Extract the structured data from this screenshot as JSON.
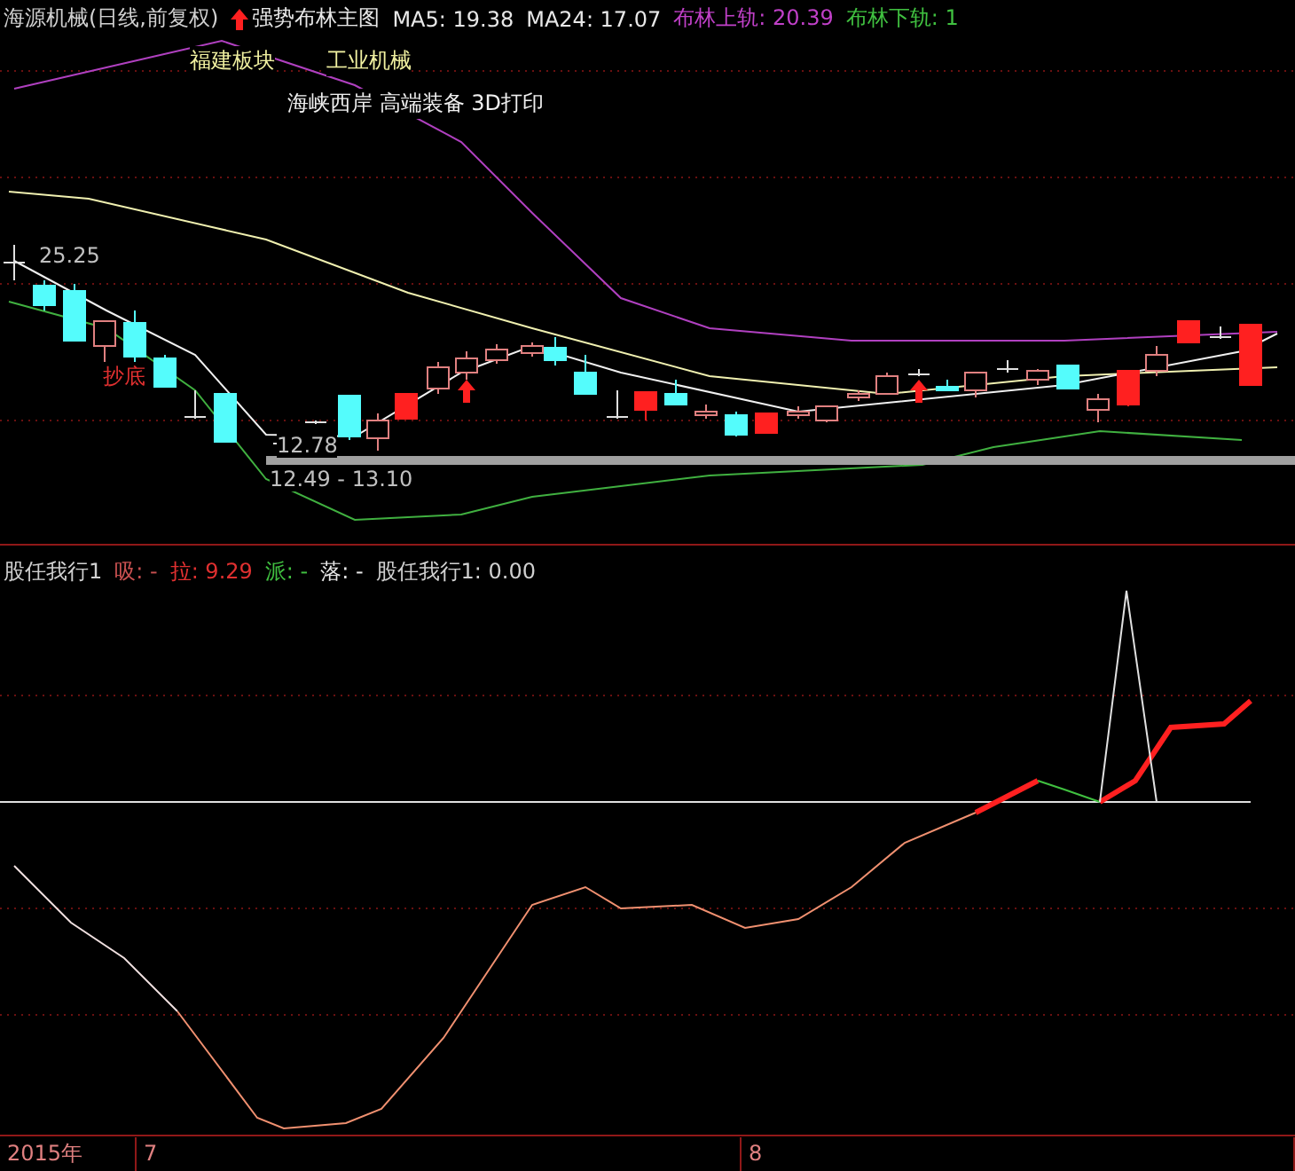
{
  "main_panel": {
    "header": [
      {
        "kind": "stock",
        "text": "海源机械(日线,前复权)",
        "color": "#d0d0d0"
      },
      {
        "kind": "indicator",
        "text": "强势布林主图",
        "color": "#e8e8e8"
      },
      {
        "kind": "value",
        "text": "MA5: 19.38",
        "color": "#e8e8e8"
      },
      {
        "kind": "value",
        "text": "MA24: 17.07",
        "color": "#e8e8e8"
      },
      {
        "kind": "value",
        "text": "布林上轨: 20.39",
        "color": "#c040c8"
      },
      {
        "kind": "value",
        "text": "布林下轨: 1",
        "color": "#40c040"
      }
    ],
    "tags": [
      "福建板块",
      "工业机械",
      "海峡西岸 高端装备 3D打印"
    ],
    "annotations": [
      "25.25",
      "抄底",
      "12.78",
      "12.49 - 13.10"
    ]
  },
  "sub_panel": {
    "header": [
      {
        "text": "股任我行1",
        "color": "#d0d0d0"
      },
      {
        "text": "吸: -",
        "color": "#c85050"
      },
      {
        "text": "拉: 9.29",
        "color": "#e03030"
      },
      {
        "text": "派: -",
        "color": "#40c040"
      },
      {
        "text": "落: -",
        "color": "#e8e8e8"
      },
      {
        "text": "股任我行1: 0.00",
        "color": "#d0d0d0"
      }
    ]
  },
  "time_axis": [
    "2015年",
    "7",
    "8"
  ]
}
